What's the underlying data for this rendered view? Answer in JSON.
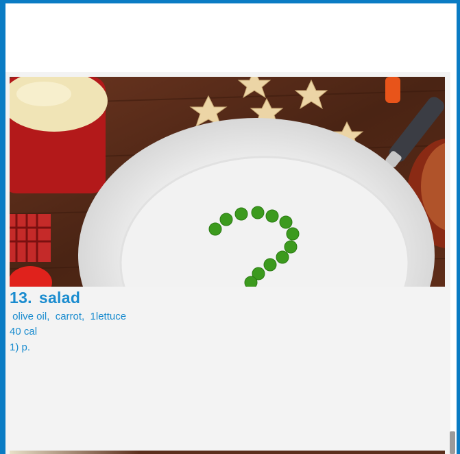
{
  "recipe": {
    "number": "13.",
    "name": "salad",
    "ingredients": " olive oil,  carrot,  1lettuce",
    "calories": "40 cal",
    "steps": "1) p."
  },
  "colors": {
    "accent": "#1a8ccf",
    "frame": "#0a7cc4",
    "background": "#f3f3f3"
  },
  "image": {
    "subject": "white plate with green peas, star-shaped crackers, red pot of mashed potatoes on wooden table"
  }
}
